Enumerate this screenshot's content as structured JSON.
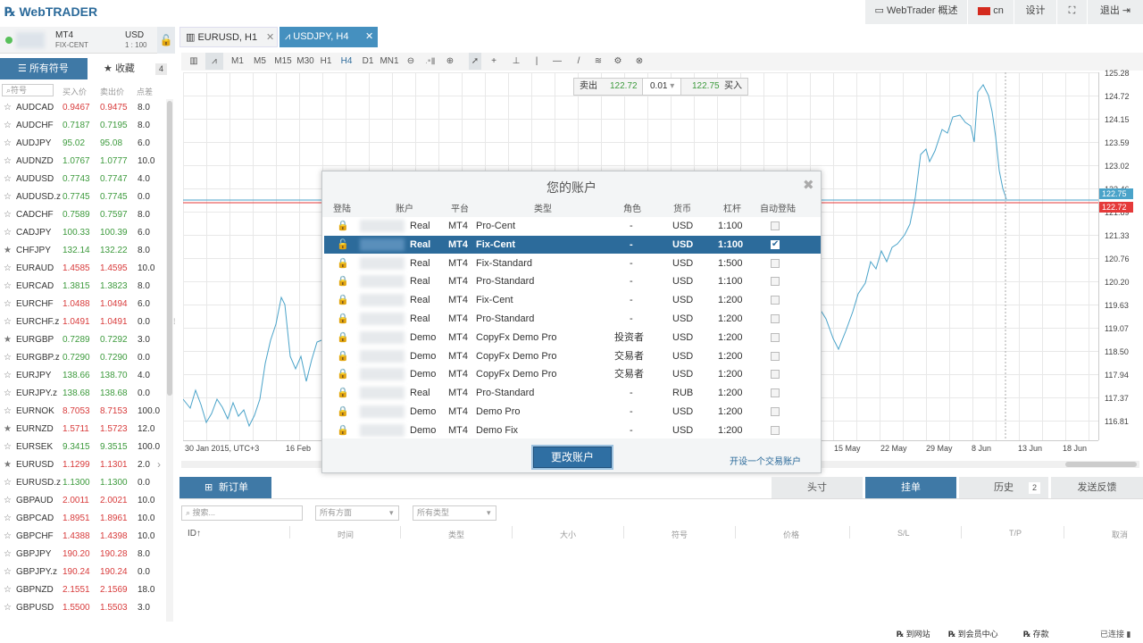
{
  "app": {
    "logo_prefix": "Web",
    "logo_suffix": "TRADER"
  },
  "topbar": {
    "overview": "WebTrader 概述",
    "lang": "cn",
    "design": "设计",
    "logout": "退出"
  },
  "account": {
    "platform": "MT4",
    "type": "FIX-CENT",
    "currency": "USD",
    "leverage": "1 : 100"
  },
  "left_tabs": {
    "all_symbols": "所有符号",
    "favorites": "收藏",
    "fav_count": "4"
  },
  "symbol_table": {
    "search_placeholder": "符号",
    "col_bid": "买入价",
    "col_ask": "卖出价",
    "col_spread": "点差",
    "rows": [
      {
        "s": "AUDCAD",
        "b": "0.9467",
        "a": "0.9475",
        "p": "8.0",
        "c": "red",
        "star": false
      },
      {
        "s": "AUDCHF",
        "b": "0.7187",
        "a": "0.7195",
        "p": "8.0",
        "c": "green",
        "star": false
      },
      {
        "s": "AUDJPY",
        "b": "95.02",
        "a": "95.08",
        "p": "6.0",
        "c": "green",
        "star": false
      },
      {
        "s": "AUDNZD",
        "b": "1.0767",
        "a": "1.0777",
        "p": "10.0",
        "c": "green",
        "star": false
      },
      {
        "s": "AUDUSD",
        "b": "0.7743",
        "a": "0.7747",
        "p": "4.0",
        "c": "green",
        "star": false
      },
      {
        "s": "AUDUSD.z",
        "b": "0.7745",
        "a": "0.7745",
        "p": "0.0",
        "c": "green",
        "star": false
      },
      {
        "s": "CADCHF",
        "b": "0.7589",
        "a": "0.7597",
        "p": "8.0",
        "c": "green",
        "star": false
      },
      {
        "s": "CADJPY",
        "b": "100.33",
        "a": "100.39",
        "p": "6.0",
        "c": "green",
        "star": false
      },
      {
        "s": "CHFJPY",
        "b": "132.14",
        "a": "132.22",
        "p": "8.0",
        "c": "green",
        "star": true
      },
      {
        "s": "EURAUD",
        "b": "1.4585",
        "a": "1.4595",
        "p": "10.0",
        "c": "red",
        "star": false
      },
      {
        "s": "EURCAD",
        "b": "1.3815",
        "a": "1.3823",
        "p": "8.0",
        "c": "green",
        "star": false
      },
      {
        "s": "EURCHF",
        "b": "1.0488",
        "a": "1.0494",
        "p": "6.0",
        "c": "red",
        "star": false
      },
      {
        "s": "EURCHF.z",
        "b": "1.0491",
        "a": "1.0491",
        "p": "0.0",
        "c": "red",
        "star": false
      },
      {
        "s": "EURGBP",
        "b": "0.7289",
        "a": "0.7292",
        "p": "3.0",
        "c": "green",
        "star": true
      },
      {
        "s": "EURGBP.z",
        "b": "0.7290",
        "a": "0.7290",
        "p": "0.0",
        "c": "green",
        "star": false
      },
      {
        "s": "EURJPY",
        "b": "138.66",
        "a": "138.70",
        "p": "4.0",
        "c": "green",
        "star": false
      },
      {
        "s": "EURJPY.z",
        "b": "138.68",
        "a": "138.68",
        "p": "0.0",
        "c": "green",
        "star": false
      },
      {
        "s": "EURNOK",
        "b": "8.7053",
        "a": "8.7153",
        "p": "100.0",
        "c": "red",
        "star": false
      },
      {
        "s": "EURNZD",
        "b": "1.5711",
        "a": "1.5723",
        "p": "12.0",
        "c": "red",
        "star": true
      },
      {
        "s": "EURSEK",
        "b": "9.3415",
        "a": "9.3515",
        "p": "100.0",
        "c": "green",
        "star": false
      },
      {
        "s": "EURUSD",
        "b": "1.1299",
        "a": "1.1301",
        "p": "2.0",
        "c": "red",
        "star": true
      },
      {
        "s": "EURUSD.z",
        "b": "1.1300",
        "a": "1.1300",
        "p": "0.0",
        "c": "green",
        "star": false
      },
      {
        "s": "GBPAUD",
        "b": "2.0011",
        "a": "2.0021",
        "p": "10.0",
        "c": "red",
        "star": false
      },
      {
        "s": "GBPCAD",
        "b": "1.8951",
        "a": "1.8961",
        "p": "10.0",
        "c": "red",
        "star": false
      },
      {
        "s": "GBPCHF",
        "b": "1.4388",
        "a": "1.4398",
        "p": "10.0",
        "c": "red",
        "star": false
      },
      {
        "s": "GBPJPY",
        "b": "190.20",
        "a": "190.28",
        "p": "8.0",
        "c": "red",
        "star": false
      },
      {
        "s": "GBPJPY.z",
        "b": "190.24",
        "a": "190.24",
        "p": "0.0",
        "c": "red",
        "star": false
      },
      {
        "s": "GBPNZD",
        "b": "2.1551",
        "a": "2.1569",
        "p": "18.0",
        "c": "red",
        "star": false
      },
      {
        "s": "GBPUSD",
        "b": "1.5500",
        "a": "1.5503",
        "p": "3.0",
        "c": "red",
        "star": false
      }
    ]
  },
  "chart_tabs": [
    {
      "label": "EURUSD, H1"
    },
    {
      "label": "USDJPY, H4"
    }
  ],
  "timeframes": [
    "M1",
    "M5",
    "M15",
    "M30",
    "H1",
    "H4",
    "D1",
    "MN1"
  ],
  "active_timeframe": "H4",
  "trade_box": {
    "sell": "卖出",
    "sell_price": "122.72",
    "lot": "0.01",
    "buy_price": "122.75",
    "buy": "买入"
  },
  "chart_data": {
    "type": "line",
    "title": "",
    "x_labels": [
      "30 Jan 2015, UTC+3",
      "16 Feb",
      "15 May",
      "22 May",
      "29 May",
      "8 Jun",
      "13 Jun",
      "18 Jun"
    ],
    "y_ticks": [
      125.28,
      124.72,
      124.15,
      123.59,
      123.02,
      122.46,
      121.89,
      121.33,
      120.76,
      120.2,
      119.63,
      119.07,
      118.5,
      117.94,
      117.37,
      116.81
    ],
    "ask_price": "122.75",
    "bid_price": "122.72",
    "ask_color": "#4aa3c9",
    "bid_color": "#e53a3a"
  },
  "modal": {
    "title": "您的账户",
    "headers": [
      "登陆",
      "账户",
      "平台",
      "类型",
      "角色",
      "货币",
      "杠杆",
      "自动登陆"
    ],
    "rows": [
      {
        "kind": "Real",
        "plat": "MT4",
        "type": "Pro-Cent",
        "role": "-",
        "cur": "USD",
        "lev": "1:100",
        "sel": false,
        "auto": false
      },
      {
        "kind": "Real",
        "plat": "MT4",
        "type": "Fix-Cent",
        "role": "-",
        "cur": "USD",
        "lev": "1:100",
        "sel": true,
        "auto": true
      },
      {
        "kind": "Real",
        "plat": "MT4",
        "type": "Fix-Standard",
        "role": "-",
        "cur": "USD",
        "lev": "1:500",
        "sel": false,
        "auto": false
      },
      {
        "kind": "Real",
        "plat": "MT4",
        "type": "Pro-Standard",
        "role": "-",
        "cur": "USD",
        "lev": "1:100",
        "sel": false,
        "auto": false
      },
      {
        "kind": "Real",
        "plat": "MT4",
        "type": "Fix-Cent",
        "role": "-",
        "cur": "USD",
        "lev": "1:200",
        "sel": false,
        "auto": false
      },
      {
        "kind": "Real",
        "plat": "MT4",
        "type": "Pro-Standard",
        "role": "-",
        "cur": "USD",
        "lev": "1:200",
        "sel": false,
        "auto": false
      },
      {
        "kind": "Demo",
        "plat": "MT4",
        "type": "CopyFx Demo Pro",
        "role": "投资者",
        "cur": "USD",
        "lev": "1:200",
        "sel": false,
        "auto": false
      },
      {
        "kind": "Demo",
        "plat": "MT4",
        "type": "CopyFx Demo Pro",
        "role": "交易者",
        "cur": "USD",
        "lev": "1:200",
        "sel": false,
        "auto": false
      },
      {
        "kind": "Demo",
        "plat": "MT4",
        "type": "CopyFx Demo Pro",
        "role": "交易者",
        "cur": "USD",
        "lev": "1:200",
        "sel": false,
        "auto": false
      },
      {
        "kind": "Real",
        "plat": "MT4",
        "type": "Pro-Standard",
        "role": "-",
        "cur": "RUB",
        "lev": "1:200",
        "sel": false,
        "auto": false
      },
      {
        "kind": "Demo",
        "plat": "MT4",
        "type": "Demo Pro",
        "role": "-",
        "cur": "USD",
        "lev": "1:200",
        "sel": false,
        "auto": false
      },
      {
        "kind": "Demo",
        "plat": "MT4",
        "type": "Demo Fix",
        "role": "-",
        "cur": "USD",
        "lev": "1:200",
        "sel": false,
        "auto": false
      }
    ],
    "change_btn": "更改账户",
    "open_link": "开设一个交易账户"
  },
  "orders": {
    "new_order": "新订单",
    "tabs": [
      "头寸",
      "挂单",
      "历史",
      "发送反馈"
    ],
    "history_count": "2",
    "search_placeholder": "搜索...",
    "direction": "所有方面",
    "type": "所有类型",
    "cols": [
      "ID",
      "时间",
      "类型",
      "大小",
      "符号",
      "价格",
      "S/L",
      "T/P",
      "取消"
    ]
  },
  "status": {
    "to_site": "到网站",
    "member": "到会员中心",
    "deposit": "存款",
    "connected": "已连接"
  }
}
